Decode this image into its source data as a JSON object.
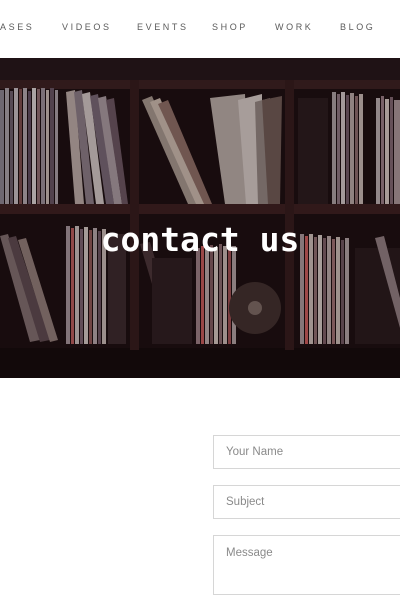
{
  "nav": {
    "items": [
      {
        "label": "ASES"
      },
      {
        "label": "VIDEOS"
      },
      {
        "label": "EVENTS"
      },
      {
        "label": "SHOP"
      },
      {
        "label": "WORK"
      },
      {
        "label": "BLOG"
      }
    ]
  },
  "hero": {
    "title": "contact us"
  },
  "form": {
    "name_placeholder": "Your Name",
    "subject_placeholder": "Subject",
    "message_placeholder": "Message"
  }
}
